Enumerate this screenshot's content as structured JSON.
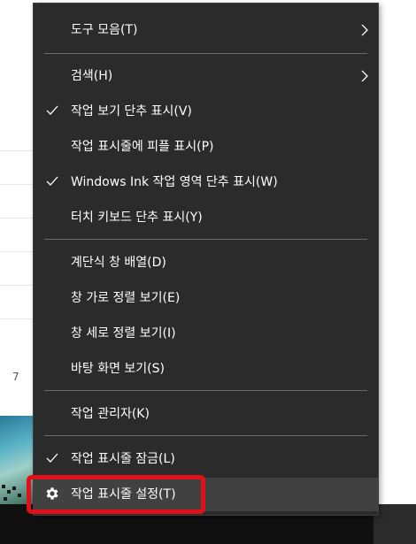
{
  "background": {
    "row_number": "7"
  },
  "menu": {
    "items": [
      {
        "label": "도구 모음(T)",
        "checked": false,
        "submenu": true
      },
      {
        "label": "검색(H)",
        "checked": false,
        "submenu": true
      },
      {
        "label": "작업 보기 단추 표시(V)",
        "checked": true,
        "submenu": false
      },
      {
        "label": "작업 표시줄에 피플 표시(P)",
        "checked": false,
        "submenu": false
      },
      {
        "label": "Windows Ink 작업 영역 단추 표시(W)",
        "checked": true,
        "submenu": false
      },
      {
        "label": "터치 키보드 단추 표시(Y)",
        "checked": false,
        "submenu": false
      },
      {
        "label": "계단식 창 배열(D)",
        "checked": false,
        "submenu": false
      },
      {
        "label": "창 가로 정렬 보기(E)",
        "checked": false,
        "submenu": false
      },
      {
        "label": "창 세로 정렬 보기(I)",
        "checked": false,
        "submenu": false
      },
      {
        "label": "바탕 화면 보기(S)",
        "checked": false,
        "submenu": false
      },
      {
        "label": "작업 관리자(K)",
        "checked": false,
        "submenu": false
      },
      {
        "label": "작업 표시줄 잠금(L)",
        "checked": true,
        "submenu": false
      },
      {
        "label": "작업 표시줄 설정(T)",
        "checked": false,
        "submenu": false,
        "icon": "gear-icon",
        "highlighted": true
      }
    ]
  },
  "colors": {
    "menu_bg": "#2b2b2b",
    "hover_bg": "#414141",
    "highlight_border": "#e0101a",
    "text": "#ffffff"
  }
}
